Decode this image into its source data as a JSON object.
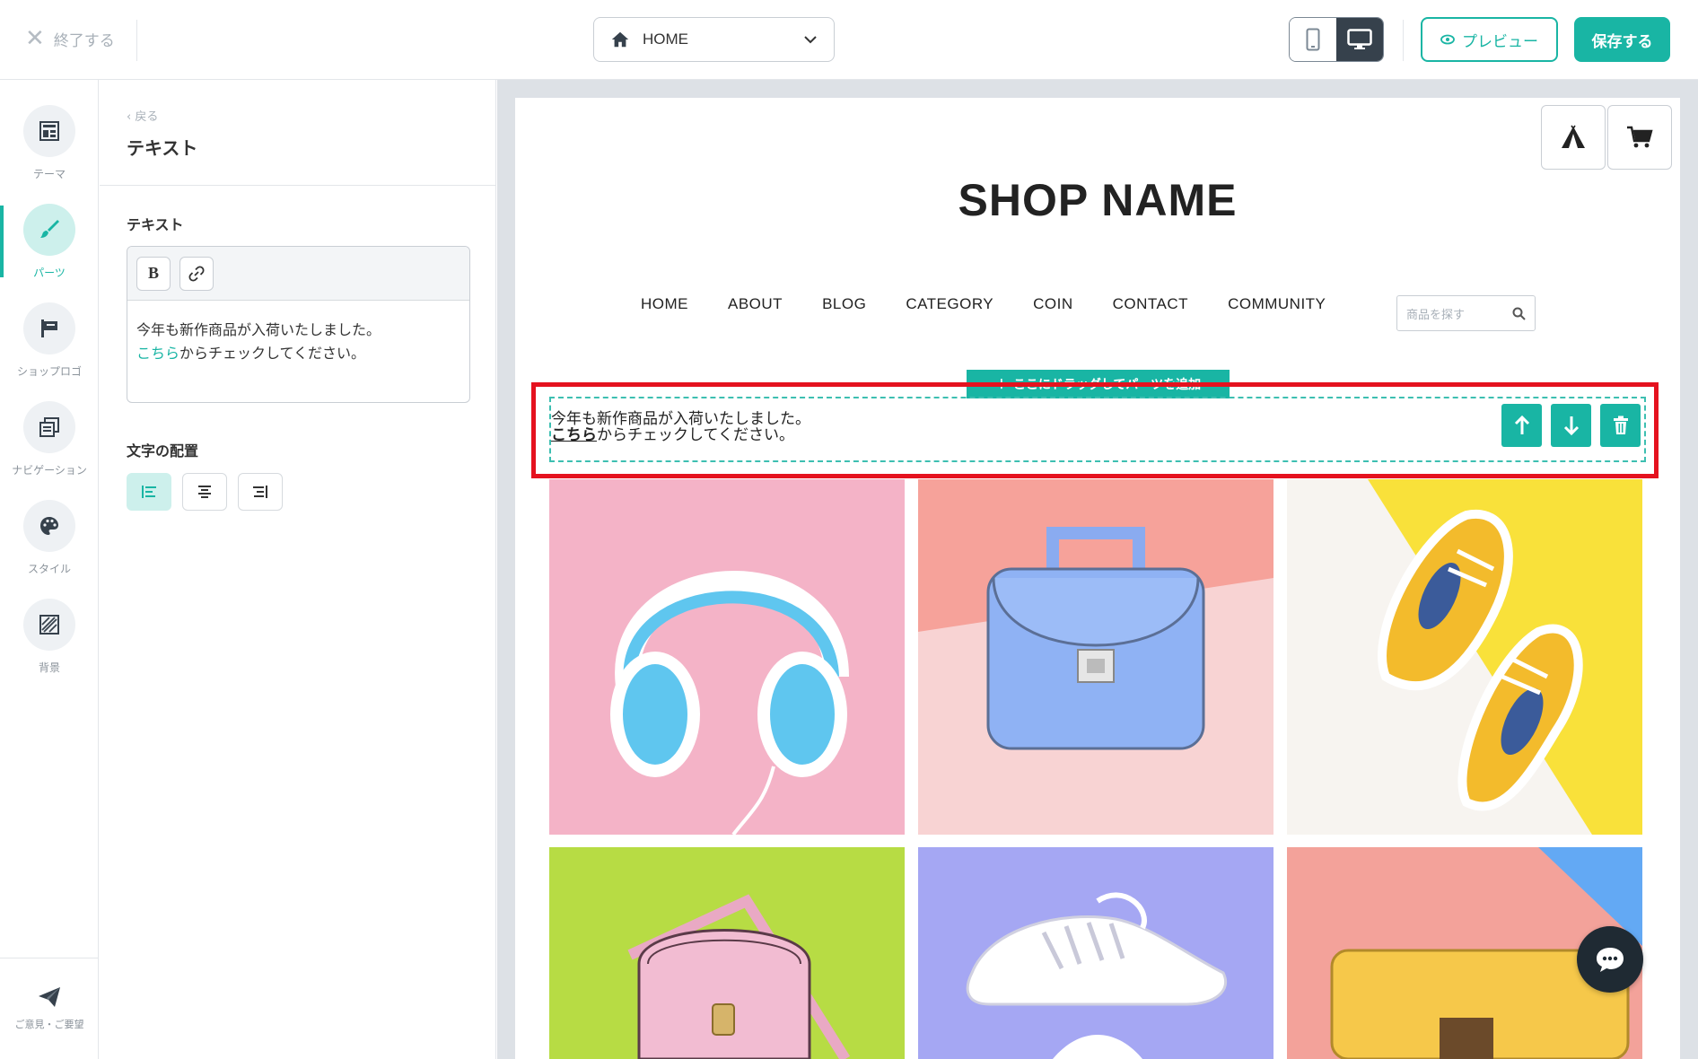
{
  "topbar": {
    "exit_label": "終了する",
    "page_select_value": "HOME",
    "preview_label": "プレビュー",
    "save_label": "保存する"
  },
  "rail": {
    "items": [
      {
        "label": "テーマ",
        "icon": "layout-icon"
      },
      {
        "label": "パーツ",
        "icon": "brush-icon"
      },
      {
        "label": "ショップロゴ",
        "icon": "flag-icon"
      },
      {
        "label": "ナビゲーション",
        "icon": "pages-icon"
      },
      {
        "label": "スタイル",
        "icon": "palette-icon"
      },
      {
        "label": "背景",
        "icon": "hatch-icon"
      }
    ],
    "feedback_label": "ご意見・ご要望"
  },
  "panel": {
    "back_label": "戻る",
    "title": "テキスト",
    "text_section_label": "テキスト",
    "editor_line1": "今年も新作商品が入荷いたしました。",
    "editor_link": "こちら",
    "editor_line2_rest": "からチェックしてください。",
    "align_section_label": "文字の配置",
    "align_selected": "left"
  },
  "preview": {
    "shop_name": "SHOP NAME",
    "nav": [
      "HOME",
      "ABOUT",
      "BLOG",
      "CATEGORY",
      "COIN",
      "CONTACT",
      "COMMUNITY"
    ],
    "search_placeholder": "商品を探す",
    "drop_banner": "ここにドラッグしてパーツを追加",
    "text_line1": "今年も新作商品が入荷いたしました。",
    "text_link": "こちら",
    "text_line2_rest": "からチェックしてください。",
    "products": [
      {
        "icon": "headphones-image"
      },
      {
        "icon": "handbag-image"
      },
      {
        "icon": "sneakers-image"
      },
      {
        "icon": "pink-bag-image"
      },
      {
        "icon": "white-sneaker-image"
      },
      {
        "icon": "yellow-wallet-image"
      }
    ]
  },
  "colors": {
    "accent": "#19b5a4",
    "dark": "#36414c",
    "highlight": "#e5121f"
  }
}
